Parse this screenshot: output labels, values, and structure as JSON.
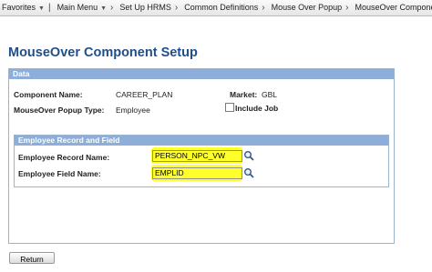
{
  "breadcrumb": {
    "items": [
      "Favorites",
      "Main Menu",
      "Set Up HRMS",
      "Common Definitions",
      "Mouse Over Popup",
      "MouseOver Component Setup"
    ]
  },
  "page": {
    "title": "MouseOver Component Setup"
  },
  "data_section": {
    "header": "Data",
    "component_name_label": "Component Name:",
    "component_name_value": "CAREER_PLAN",
    "market_label": "Market:",
    "market_value": "GBL",
    "popup_type_label": "MouseOver Popup Type:",
    "popup_type_value": "Employee",
    "include_job_label": "Include Job",
    "include_job_checked": false
  },
  "employee_section": {
    "header": "Employee Record and Field",
    "record_label": "Employee Record Name:",
    "record_value": "PERSON_NPC_VW",
    "field_label": "Employee Field Name:",
    "field_value": "EMPLID"
  },
  "actions": {
    "return_label": "Return"
  },
  "colors": {
    "title": "#1f4f8a",
    "section_header": "#8caed8",
    "highlight": "#ffff2a"
  }
}
